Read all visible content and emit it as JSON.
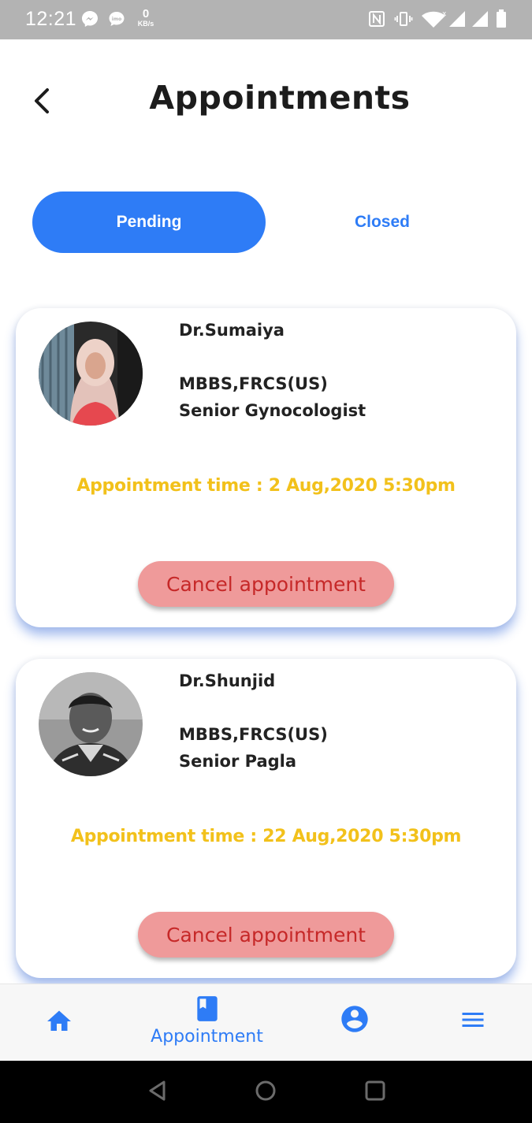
{
  "status_bar": {
    "time": "12:21",
    "net_speed_value": "0",
    "net_speed_unit": "KB/s",
    "icons": [
      "messenger-icon",
      "imo-icon",
      "nfc-icon",
      "vibrate-icon",
      "wifi-icon",
      "signal-icon",
      "signal-icon",
      "battery-icon"
    ]
  },
  "header": {
    "title": "Appointments",
    "back_icon": "chevron-left-icon"
  },
  "tabs": [
    {
      "label": "Pending",
      "active": true
    },
    {
      "label": "Closed",
      "active": false
    }
  ],
  "appointments": [
    {
      "name": "Dr.Sumaiya",
      "degree": "MBBS,FRCS(US)",
      "title": "Senior Gynocologist",
      "time": "Appointment time : 2 Aug,2020 5:30pm",
      "action": "Cancel appointment"
    },
    {
      "name": "Dr.Shunjid",
      "degree": "MBBS,FRCS(US)",
      "title": "Senior Pagla",
      "time": "Appointment time : 22 Aug,2020 5:30pm",
      "action": "Cancel appointment"
    }
  ],
  "bottom_nav": {
    "items": [
      {
        "icon": "home-icon",
        "label": ""
      },
      {
        "icon": "book-icon",
        "label": "Appointment"
      },
      {
        "icon": "account-circle-icon",
        "label": ""
      },
      {
        "icon": "menu-icon",
        "label": ""
      }
    ]
  },
  "colors": {
    "primary": "#2e7cf6",
    "time_text": "#f2c11b",
    "cancel_bg": "#ef9a9a",
    "cancel_text": "#c62828",
    "status_bar": "#b3b3b3"
  }
}
